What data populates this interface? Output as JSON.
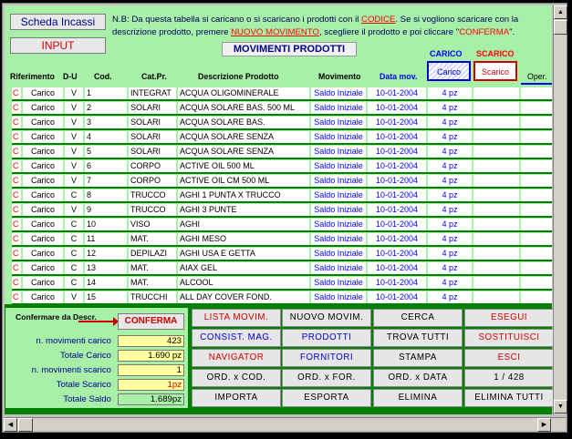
{
  "header": {
    "scheda_incassi": "Scheda Incassi",
    "input": "INPUT",
    "note_p1": "N.B: Da questa tabella si caricano o si scaricano i prodotti con il ",
    "note_codice": "CODICE",
    "note_p2": ". Se si vogliono scaricare con la",
    "note_p3": "descrizione prodotto, premere ",
    "note_nuovo": "NUOVO MOVIMENTO",
    "note_p4": ", scegliere il prodotto e poi cliccare \"",
    "note_conferma": "CONFERMA",
    "note_p5": "\".",
    "title": "MOVIMENTI PRODOTTI",
    "carico_label": "CARICO",
    "scarico_label": "SCARICO",
    "carico_btn": "Carico",
    "scarico_btn": "Scarico"
  },
  "columns": {
    "riferimento": "Riferimento",
    "du": "D-U",
    "cod": "Cod.",
    "catpr": "Cat.Pr.",
    "descrizione": "Descrizione Prodotto",
    "movimento": "Movimento",
    "datamov": "Data mov.",
    "carico": "Carico",
    "scarico": "Scarico",
    "oper": "Oper."
  },
  "rows": [
    {
      "flag": "C",
      "rif": "Carico",
      "du": "V",
      "cod": "1",
      "cat": "INTEGRAT",
      "desc": "ACQUA OLIGOMINERALE",
      "mov": "Saldo Iniziale",
      "data": "10-01-2004",
      "carico": "4 pz"
    },
    {
      "flag": "C",
      "rif": "Carico",
      "du": "V",
      "cod": "2",
      "cat": "SOLARI",
      "desc": "ACQUA SOLARE BAS. 500 ML",
      "mov": "Saldo Iniziale",
      "data": "10-01-2004",
      "carico": "4 pz"
    },
    {
      "flag": "C",
      "rif": "Carico",
      "du": "V",
      "cod": "3",
      "cat": "SOLARI",
      "desc": "ACQUA SOLARE BAS.",
      "mov": "Saldo Iniziale",
      "data": "10-01-2004",
      "carico": "4 pz"
    },
    {
      "flag": "C",
      "rif": "Carico",
      "du": "V",
      "cod": "4",
      "cat": "SOLARI",
      "desc": "ACQUA SOLARE SENZA",
      "mov": "Saldo Iniziale",
      "data": "10-01-2004",
      "carico": "4 pz"
    },
    {
      "flag": "C",
      "rif": "Carico",
      "du": "V",
      "cod": "5",
      "cat": "SOLARI",
      "desc": "ACQUA SOLARE SENZA",
      "mov": "Saldo Iniziale",
      "data": "10-01-2004",
      "carico": "4 pz"
    },
    {
      "flag": "C",
      "rif": "Carico",
      "du": "V",
      "cod": "6",
      "cat": "CORPO",
      "desc": "ACTIVE OIL 500 ML",
      "mov": "Saldo Iniziale",
      "data": "10-01-2004",
      "carico": "4 pz"
    },
    {
      "flag": "C",
      "rif": "Carico",
      "du": "V",
      "cod": "7",
      "cat": "CORPO",
      "desc": "ACTIVE OIL CM 500 ML",
      "mov": "Saldo Iniziale",
      "data": "10-01-2004",
      "carico": "4 pz"
    },
    {
      "flag": "C",
      "rif": "Carico",
      "du": "C",
      "cod": "8",
      "cat": "TRUCCO",
      "desc": "AGHI 1 PUNTA X TRUCCO",
      "mov": "Saldo Iniziale",
      "data": "10-01-2004",
      "carico": "4 pz"
    },
    {
      "flag": "C",
      "rif": "Carico",
      "du": "V",
      "cod": "9",
      "cat": "TRUCCO",
      "desc": "AGHI 3 PUNTE",
      "mov": "Saldo Iniziale",
      "data": "10-01-2004",
      "carico": "4 pz"
    },
    {
      "flag": "C",
      "rif": "Carico",
      "du": "C",
      "cod": "10",
      "cat": "VISO",
      "desc": "AGHI",
      "mov": "Saldo Iniziale",
      "data": "10-01-2004",
      "carico": "4 pz"
    },
    {
      "flag": "C",
      "rif": "Carico",
      "du": "C",
      "cod": "11",
      "cat": "MAT.",
      "desc": "AGHI MESO",
      "mov": "Saldo Iniziale",
      "data": "10-01-2004",
      "carico": "4 pz"
    },
    {
      "flag": "C",
      "rif": "Carico",
      "du": "C",
      "cod": "12",
      "cat": "DEPILAZI",
      "desc": "AGHI USA E GETTA",
      "mov": "Saldo Iniziale",
      "data": "10-01-2004",
      "carico": "4 pz"
    },
    {
      "flag": "C",
      "rif": "Carico",
      "du": "C",
      "cod": "13",
      "cat": "MAT.",
      "desc": "AIAX GEL",
      "mov": "Saldo Iniziale",
      "data": "10-01-2004",
      "carico": "4 pz"
    },
    {
      "flag": "C",
      "rif": "Carico",
      "du": "C",
      "cod": "14",
      "cat": "MAT.",
      "desc": "ALCOOL",
      "mov": "Saldo Iniziale",
      "data": "10-01-2004",
      "carico": "4 pz"
    },
    {
      "flag": "C",
      "rif": "Carico",
      "du": "V",
      "cod": "15",
      "cat": "TRUCCHI",
      "desc": "ALL DAY COVER FOND.",
      "mov": "Saldo Iniziale",
      "data": "10-01-2004",
      "carico": "4 pz"
    }
  ],
  "left_panel": {
    "confirm_label": "Confermare da Descr.",
    "confirm_btn": "CONFERMA",
    "stats": [
      {
        "label": "n. movimenti carico",
        "value": "423",
        "bg": "#ffffa0"
      },
      {
        "label": "Totale Carico",
        "value": "1.690 pz",
        "bg": "#ffffa0"
      },
      {
        "label": "n. movimenti scarico",
        "value": "1",
        "bg": "#ffffa0"
      },
      {
        "label": "Totale Scarico",
        "value": "1pz",
        "bg": "#ffffa0"
      },
      {
        "label": "Totale Saldo",
        "value": "1.689pz",
        "bg": "#a8f0a8"
      }
    ]
  },
  "buttons": [
    [
      {
        "label": "LISTA MOVIM.",
        "color": "#cc0000"
      },
      {
        "label": "NUOVO MOVIM.",
        "color": "#000000"
      },
      {
        "label": "CERCA",
        "color": "#000000"
      },
      {
        "label": "ESEGUI",
        "color": "#cc0000"
      }
    ],
    [
      {
        "label": "CONSIST. MAG.",
        "color": "#0000cc"
      },
      {
        "label": "PRODOTTI",
        "color": "#0000cc"
      },
      {
        "label": "TROVA TUTTI",
        "color": "#000000"
      },
      {
        "label": "SOSTITUISCI",
        "color": "#cc0000"
      }
    ],
    [
      {
        "label": "NAVIGATOR",
        "color": "#cc0000"
      },
      {
        "label": "FORNITORI",
        "color": "#0000cc"
      },
      {
        "label": "STAMPA",
        "color": "#000000"
      },
      {
        "label": "ESCI",
        "color": "#cc0000"
      }
    ],
    [
      {
        "label": "ORD. x COD.",
        "color": "#000000"
      },
      {
        "label": "ORD. x FOR.",
        "color": "#000000"
      },
      {
        "label": "ORD. x DATA",
        "color": "#000000"
      },
      {
        "label": "1    /  428",
        "color": "#000000"
      }
    ],
    [
      {
        "label": "IMPORTA",
        "color": "#000000"
      },
      {
        "label": "ESPORTA",
        "color": "#000000"
      },
      {
        "label": "ELIMINA",
        "color": "#000000"
      },
      {
        "label": "ELIMINA TUTTI",
        "color": "#000000"
      }
    ]
  ]
}
